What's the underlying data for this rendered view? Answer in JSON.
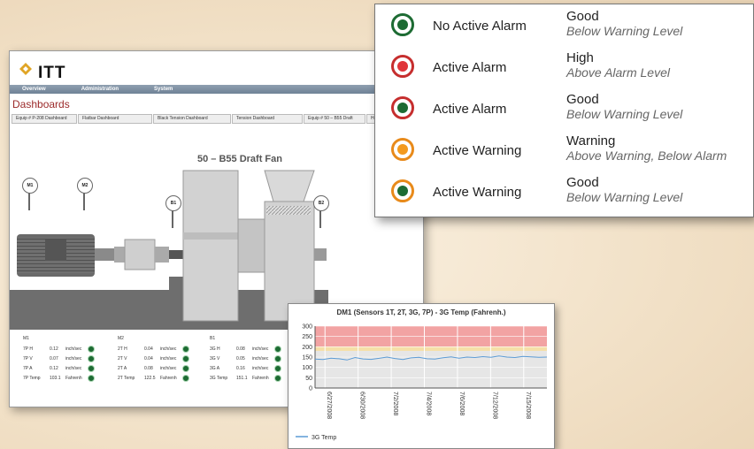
{
  "window": {
    "logo": "ITT",
    "menu": [
      "Overview",
      "Administration",
      "System"
    ],
    "page_title": "Dashboards",
    "tabs": [
      "Equip # P-208 Dashboard",
      "Flatbar Dashboard",
      "Black Tension Dashboard",
      "Tension Dashboard",
      "Equip # 50 – B55 Draft",
      "Holland Shredder"
    ],
    "diagram_title": "50 – B55 Draft Fan",
    "sensors": [
      "M1",
      "M2",
      "B1",
      "B2"
    ]
  },
  "readings": [
    {
      "header": "M1",
      "rows": [
        {
          "name": "7P H",
          "value": "0.12",
          "unit": "inch/sec"
        },
        {
          "name": "7P V",
          "value": "0.07",
          "unit": "inch/sec"
        },
        {
          "name": "7P A",
          "value": "0.12",
          "unit": "inch/sec"
        },
        {
          "name": "7P Temp",
          "value": "103.1",
          "unit": "Fahrenh"
        }
      ]
    },
    {
      "header": "M2",
      "rows": [
        {
          "name": "2T H",
          "value": "0.04",
          "unit": "inch/sec"
        },
        {
          "name": "2T V",
          "value": "0.04",
          "unit": "inch/sec"
        },
        {
          "name": "2T A",
          "value": "0.08",
          "unit": "inch/sec"
        },
        {
          "name": "2T Temp",
          "value": "122.5",
          "unit": "Fahrenh"
        }
      ]
    },
    {
      "header": "B1",
      "rows": [
        {
          "name": "3G H",
          "value": "0.08",
          "unit": "inch/sec"
        },
        {
          "name": "3G V",
          "value": "0.05",
          "unit": "inch/sec"
        },
        {
          "name": "3G A",
          "value": "0.16",
          "unit": "inch/sec"
        },
        {
          "name": "3G Temp",
          "value": "151.1",
          "unit": "Fahrenh"
        }
      ]
    }
  ],
  "legend": [
    {
      "status": "No Active Alarm",
      "level": "Good",
      "desc": "Below Warning Level",
      "ring": "#1d6b33",
      "core": "#1d6b33"
    },
    {
      "status": "Active Alarm",
      "level": "High",
      "desc": "Above Alarm Level",
      "ring": "#c62e2e",
      "core": "#e0353a"
    },
    {
      "status": "Active Alarm",
      "level": "Good",
      "desc": "Below Warning Level",
      "ring": "#c62e2e",
      "core": "#1d6b33"
    },
    {
      "status": "Active Warning",
      "level": "Warning",
      "desc": "Above Warning, Below Alarm",
      "ring": "#e88a1a",
      "core": "#f39a1f"
    },
    {
      "status": "Active Warning",
      "level": "Good",
      "desc": "Below Warning Level",
      "ring": "#e88a1a",
      "core": "#1d6b33"
    }
  ],
  "chart_data": {
    "type": "line",
    "title": "DM1 (Sensors 1T, 2T, 3G, 7P) - 3G Temp (Fahrenh.)",
    "ylim": [
      0,
      300
    ],
    "yticks": [
      "300",
      "250",
      "200",
      "150",
      "100",
      "50",
      "0"
    ],
    "x_ticks": [
      "6/27/2008",
      "6/30/2008",
      "7/2/2008",
      "7/4/2008",
      "7/6/2008",
      "7/12/2008",
      "7/15/2008"
    ],
    "alarm_band": [
      200,
      300
    ],
    "warning_band": [
      180,
      200
    ],
    "series": [
      {
        "name": "3G Temp",
        "color": "#5b9bd5",
        "values": [
          140,
          138,
          145,
          142,
          136,
          148,
          141,
          139,
          144,
          150,
          143,
          138,
          146,
          149,
          142,
          140,
          147,
          151,
          145,
          150,
          148,
          152,
          149,
          155,
          150,
          148,
          153,
          151,
          149,
          150
        ]
      }
    ],
    "legend_position": "bottom-left"
  }
}
